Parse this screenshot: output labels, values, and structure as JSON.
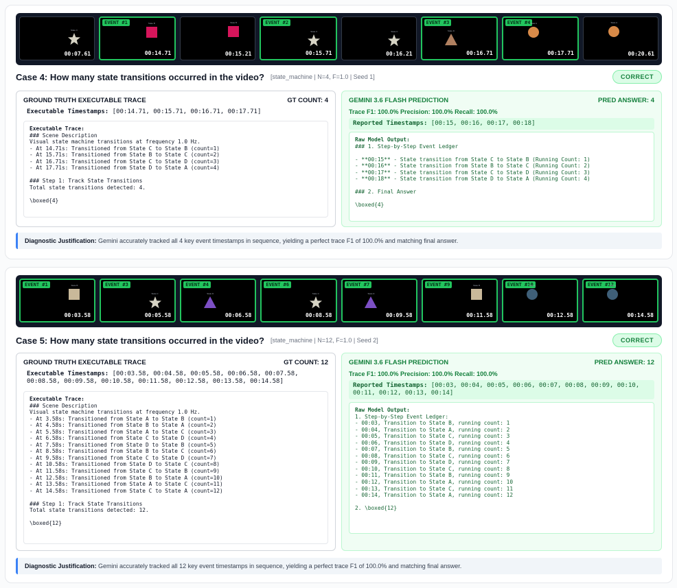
{
  "cases": [
    {
      "title": "Case 4: How many state transitions occurred in the video?",
      "meta": "[state_machine | N=4, F=1.0 | Seed 1]",
      "verdict": "CORRECT",
      "frames": [
        {
          "event": "",
          "timestamp": "00:07.61",
          "shape": "star",
          "color": "#d6d3c4",
          "label": "State C"
        },
        {
          "event": "EVENT #1",
          "timestamp": "00:14.71",
          "shape": "square",
          "color": "#d6155b",
          "label": "State B"
        },
        {
          "event": "",
          "timestamp": "00:15.21",
          "shape": "square",
          "color": "#d6155b",
          "label": "State B"
        },
        {
          "event": "EVENT #2",
          "timestamp": "00:15.71",
          "shape": "star",
          "color": "#d6d3c4",
          "label": "State C"
        },
        {
          "event": "",
          "timestamp": "00:16.21",
          "shape": "star",
          "color": "#d6d3c4",
          "label": "State C"
        },
        {
          "event": "EVENT #3",
          "timestamp": "00:16.71",
          "shape": "triangle",
          "color": "#b08060",
          "label": "State D"
        },
        {
          "event": "EVENT #4",
          "timestamp": "00:17.71",
          "shape": "circle",
          "color": "#d88a48",
          "label": "State A"
        },
        {
          "event": "",
          "timestamp": "00:20.61",
          "shape": "circle",
          "color": "#d88a48",
          "label": "State A"
        }
      ],
      "gt": {
        "heading": "GROUND TRUTH EXECUTABLE TRACE",
        "count_label": "GT COUNT:",
        "count": "4",
        "timestamps_label": "Executable Timestamps:",
        "timestamps": "[00:14.71, 00:15.71, 00:16.71, 00:17.71]",
        "trace_heading": "Executable Trace:",
        "trace": "### Scene Description\nVisual state machine transitions at frequency 1.0 Hz.\n- At 14.71s: Transitioned from State C to State B (count=1)\n- At 15.71s: Transitioned from State B to State C (count=2)\n- At 16.71s: Transitioned from State C to State D (count=3)\n- At 17.71s: Transitioned from State D to State A (count=4)\n\n### Step 1: Track State Transitions\nTotal state transitions detected: 4.\n\n\\boxed{4}"
      },
      "pred": {
        "heading": "GEMINI 3.6 FLASH PREDICTION",
        "answer_label": "PRED ANSWER:",
        "answer": "4",
        "metrics": "Trace F1: 100.0%   Precision: 100.0%   Recall: 100.0%",
        "reported_label": "Reported Timestamps:",
        "reported": "[00:15, 00:16, 00:17, 00:18]",
        "output_heading": "Raw Model Output:",
        "output": "### 1. Step-by-Step Event Ledger\n\n- **00:15** - State transition from State C to State B (Running Count: 1)\n- **00:16** - State transition from State B to State C (Running Count: 2)\n- **00:17** - State transition from State C to State D (Running Count: 3)\n- **00:18** - State transition from State D to State A (Running Count: 4)\n\n### 2. Final Answer\n\n\\boxed{4}"
      },
      "diag_label": "Diagnostic Justification:",
      "diag": "Gemini accurately tracked all 4 key event timestamps in sequence, yielding a perfect trace F1 of 100.0% and matching final answer."
    },
    {
      "title": "Case 5: How many state transitions occurred in the video?",
      "meta": "[state_machine | N=12, F=1.0 | Seed 2]",
      "verdict": "CORRECT",
      "frames": [
        {
          "event": "EVENT #1",
          "timestamp": "00:03.58",
          "shape": "square",
          "color": "#c9b99a",
          "label": "State B"
        },
        {
          "event": "EVENT #3",
          "timestamp": "00:05.58",
          "shape": "star",
          "color": "#d6d3c4",
          "label": "State C"
        },
        {
          "event": "EVENT #4",
          "timestamp": "00:06.58",
          "shape": "triangle",
          "color": "#7c4fc4",
          "label": "State D"
        },
        {
          "event": "EVENT #6",
          "timestamp": "00:08.58",
          "shape": "star",
          "color": "#d6d3c4",
          "label": "State C"
        },
        {
          "event": "EVENT #7",
          "timestamp": "00:09.58",
          "shape": "triangle",
          "color": "#7c4fc4",
          "label": "State D"
        },
        {
          "event": "EVENT #9",
          "timestamp": "00:11.58",
          "shape": "square",
          "color": "#c9b99a",
          "label": "State B"
        },
        {
          "event": "EVENT #10",
          "timestamp": "00:12.58",
          "shape": "circle",
          "color": "#3f5f78",
          "label": "State A"
        },
        {
          "event": "EVENT #12",
          "timestamp": "00:14.58",
          "shape": "circle",
          "color": "#3f5f78",
          "label": "State A"
        }
      ],
      "gt": {
        "heading": "GROUND TRUTH EXECUTABLE TRACE",
        "count_label": "GT COUNT:",
        "count": "12",
        "timestamps_label": "Executable Timestamps:",
        "timestamps": "[00:03.58, 00:04.58, 00:05.58, 00:06.58, 00:07.58, 00:08.58, 00:09.58, 00:10.58, 00:11.58, 00:12.58, 00:13.58, 00:14.58]",
        "trace_heading": "Executable Trace:",
        "trace": "### Scene Description\nVisual state machine transitions at frequency 1.0 Hz.\n- At 3.58s: Transitioned from State A to State B (count=1)\n- At 4.58s: Transitioned from State B to State A (count=2)\n- At 5.58s: Transitioned from State A to State C (count=3)\n- At 6.58s: Transitioned from State C to State D (count=4)\n- At 7.58s: Transitioned from State D to State B (count=5)\n- At 8.58s: Transitioned from State B to State C (count=6)\n- At 9.58s: Transitioned from State C to State D (count=7)\n- At 10.58s: Transitioned from State D to State C (count=8)\n- At 11.58s: Transitioned from State C to State B (count=9)\n- At 12.58s: Transitioned from State B to State A (count=10)\n- At 13.58s: Transitioned from State A to State C (count=11)\n- At 14.58s: Transitioned from State C to State A (count=12)\n\n### Step 1: Track State Transitions\nTotal state transitions detected: 12.\n\n\\boxed{12}"
      },
      "pred": {
        "heading": "GEMINI 3.6 FLASH PREDICTION",
        "answer_label": "PRED ANSWER:",
        "answer": "12",
        "metrics": "Trace F1: 100.0%   Precision: 100.0%   Recall: 100.0%",
        "reported_label": "Reported Timestamps:",
        "reported": "[00:03, 00:04, 00:05, 00:06, 00:07, 00:08, 00:09, 00:10, 00:11, 00:12, 00:13, 00:14]",
        "output_heading": "Raw Model Output:",
        "output": "1. Step-by-Step Event Ledger:\n- 00:03, Transition to State B, running count: 1\n- 00:04, Transition to State A, running count: 2\n- 00:05, Transition to State C, running count: 3\n- 00:06, Transition to State D, running count: 4\n- 00:07, Transition to State B, running count: 5\n- 00:08, Transition to State C, running count: 6\n- 00:09, Transition to State D, running count: 7\n- 00:10, Transition to State C, running count: 8\n- 00:11, Transition to State B, running count: 9\n- 00:12, Transition to State A, running count: 10\n- 00:13, Transition to State C, running count: 11\n- 00:14, Transition to State A, running count: 12\n\n2. \\boxed{12}"
      },
      "diag_label": "Diagnostic Justification:",
      "diag": "Gemini accurately tracked all 12 key event timestamps in sequence, yielding a perfect trace F1 of 100.0% and matching final answer."
    }
  ]
}
